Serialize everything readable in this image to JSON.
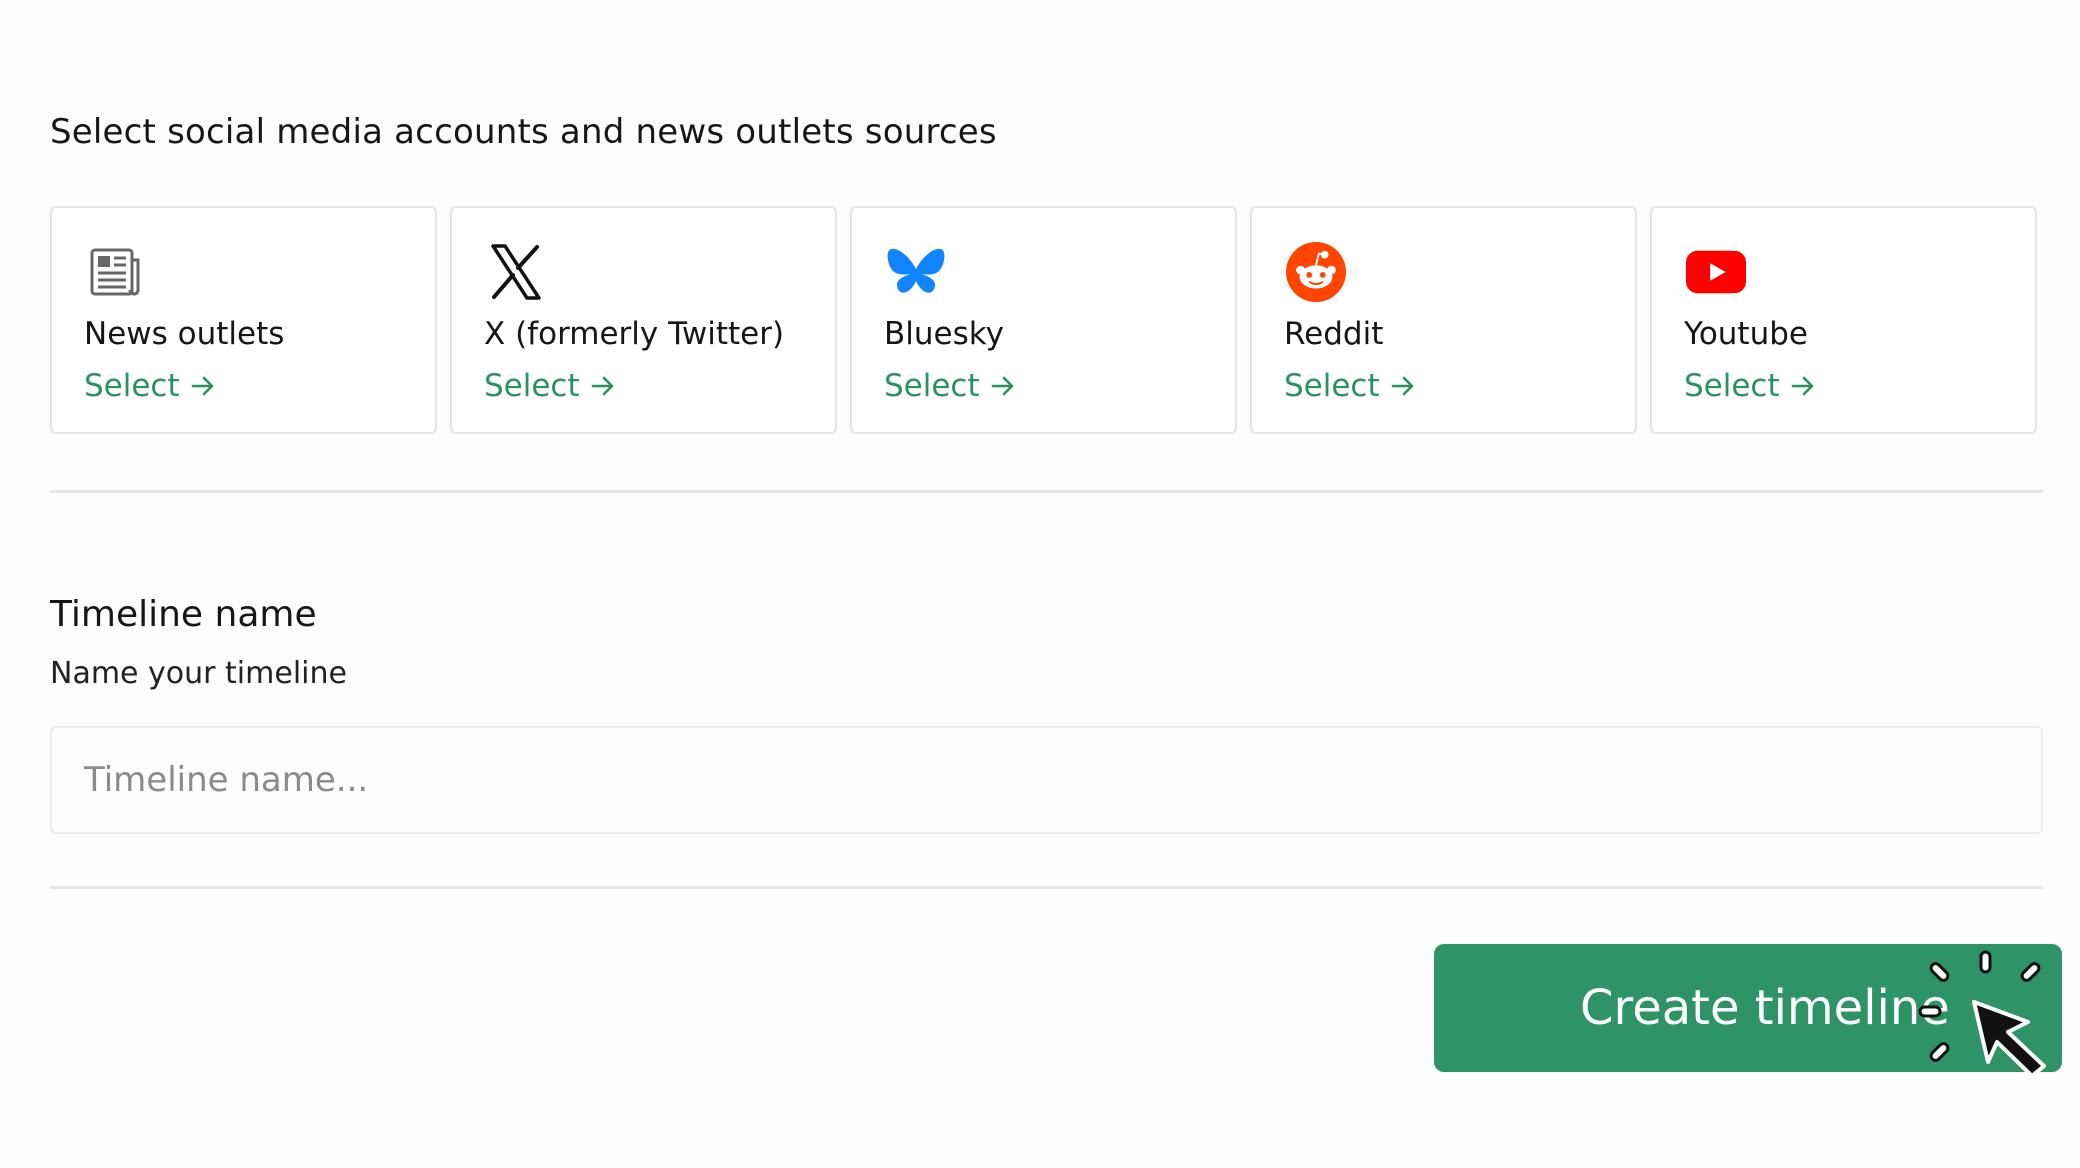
{
  "sources": {
    "heading": "Select social media accounts and news outlets sources",
    "cards": [
      {
        "label": "News outlets",
        "select_label": "Select",
        "icon": "newspaper-icon"
      },
      {
        "label": "X (formerly Twitter)",
        "select_label": "Select",
        "icon": "x-logo-icon"
      },
      {
        "label": "Bluesky",
        "select_label": "Select",
        "icon": "bluesky-butterfly-icon"
      },
      {
        "label": "Reddit",
        "select_label": "Select",
        "icon": "reddit-logo-icon"
      },
      {
        "label": "Youtube",
        "select_label": "Select",
        "icon": "youtube-logo-icon"
      }
    ]
  },
  "timeline": {
    "title": "Timeline name",
    "subtitle": "Name your timeline",
    "input_placeholder": "Timeline name...",
    "input_value": ""
  },
  "actions": {
    "create_label": "Create timeline"
  },
  "colors": {
    "accent": "#2e8f63",
    "button": "#2e9467",
    "reddit": "#ff4500",
    "youtube": "#ff0000",
    "bluesky": "#1185fe"
  }
}
